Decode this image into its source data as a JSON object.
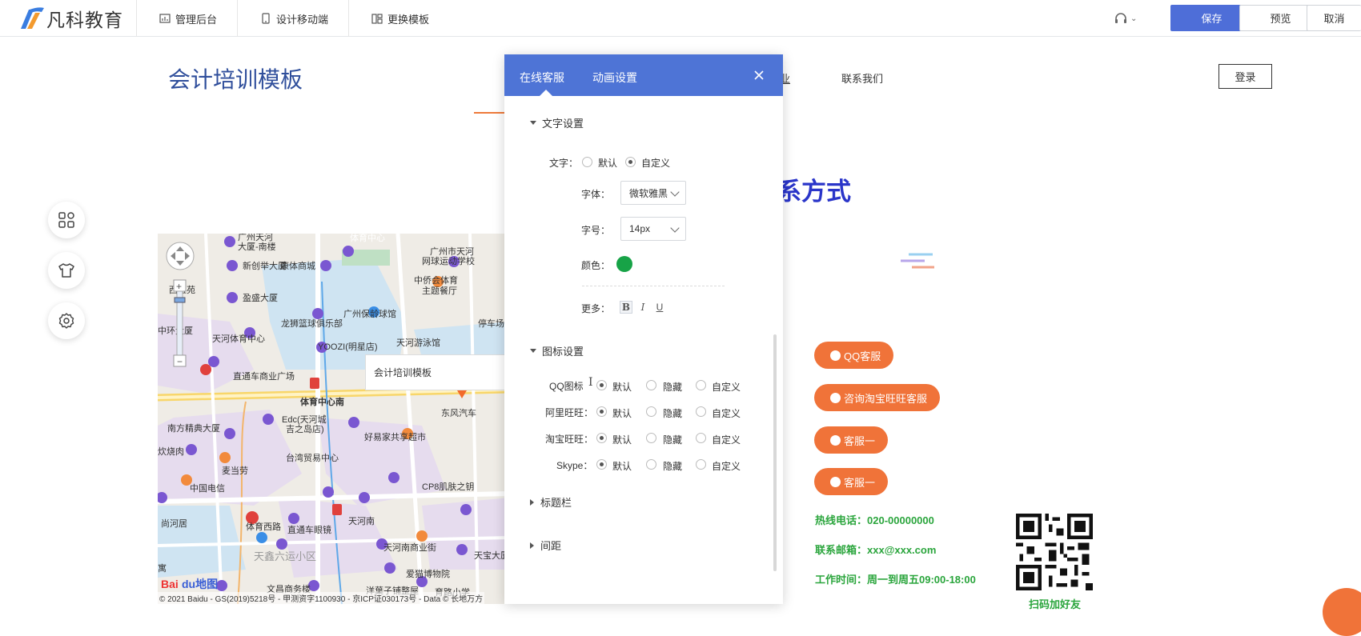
{
  "app": {
    "brand": "凡科教育",
    "nav": [
      {
        "label": "管理后台",
        "icon": "bar-chart-icon"
      },
      {
        "label": "设计移动端",
        "icon": "mobile-icon"
      },
      {
        "label": "更换模板",
        "icon": "template-icon"
      }
    ],
    "save_label": "保存",
    "preview_label": "预览",
    "cancel_label": "取消"
  },
  "site": {
    "title": "会计培训模板",
    "nav_truncated": "业",
    "nav_contact": "联系我们",
    "login_label": "登录",
    "contact_heading": "系方式"
  },
  "map": {
    "copyright": "© 2021 Baidu - GS(2019)5218号 - 甲测资字1100930 - 京ICP证030173号 - Data © 长地万方",
    "popup_title": "会计培训模板",
    "logo_text": "Bai 地图",
    "places": [
      "广州天河",
      "体育中心",
      "康体商城",
      "广州市天河",
      "网球运动学校",
      "新创举大厦",
      "西雅苑",
      "中侨会体育",
      "主题餐厅",
      "盈盛大厦",
      "广州保龄球馆",
      "龙狮篮球俱乐部",
      "停车场",
      "中环大厦",
      "天河体育中心",
      "YOOZI(明星店)",
      "天河游泳馆",
      "直通车商业广场",
      "体育中心南",
      "东风汽车",
      "南方精典大厦",
      "Edc(天河城",
      "吉之岛店)",
      "好易家共享超市",
      "炊烧肉",
      "麦当劳",
      "台湾贸易中心",
      "CP8肌肤之钥",
      "中国电信",
      "尚河居",
      "体育西路",
      "直通车眼镜",
      "天河南",
      "天河南商业街",
      "天宝大厦",
      "天鑫六运小区",
      "爱猫博物院",
      "文昌商务楼",
      "洋葉子铺整屋",
      "育路小学"
    ]
  },
  "panel": {
    "tabs": [
      "在线客服",
      "动画设置"
    ],
    "text_section": "文字设置",
    "text_label": "文字：",
    "text_options": [
      "默认",
      "自定义"
    ],
    "text_selected": "自定义",
    "font_label": "字体：",
    "font_value": "微软雅黑",
    "size_label": "字号：",
    "size_value": "14px",
    "color_label": "颜色：",
    "color_value": "#17a347",
    "more_label": "更多：",
    "format_buttons": [
      "B",
      "I",
      "U"
    ],
    "icon_section": "图标设置",
    "icon_rows": [
      {
        "label": "QQ图标",
        "options": [
          "默认",
          "隐藏",
          "自定义"
        ],
        "selected": "默认"
      },
      {
        "label": "阿里旺旺：",
        "options": [
          "默认",
          "隐藏",
          "自定义"
        ],
        "selected": "默认"
      },
      {
        "label": "淘宝旺旺：",
        "options": [
          "默认",
          "隐藏",
          "自定义"
        ],
        "selected": "默认"
      },
      {
        "label": "Skype：",
        "options": [
          "默认",
          "隐藏",
          "自定义"
        ],
        "selected": "默认"
      }
    ],
    "collapsed_sections": [
      "标题栏",
      "间距"
    ]
  },
  "contact": {
    "buttons": [
      "QQ客服",
      "咨询淘宝旺旺客服",
      "客服一",
      "客服一"
    ],
    "hotline": "热线电话：020-00000000",
    "email": "联系邮箱：xxx@xxx.com",
    "hours": "工作时间：周一到周五09:00-18:00",
    "qr_caption": "扫码加好友"
  },
  "colors": {
    "accent": "#4e74d6",
    "orange": "#f07339",
    "green": "#2aa53c",
    "heading": "#2a35c9"
  }
}
